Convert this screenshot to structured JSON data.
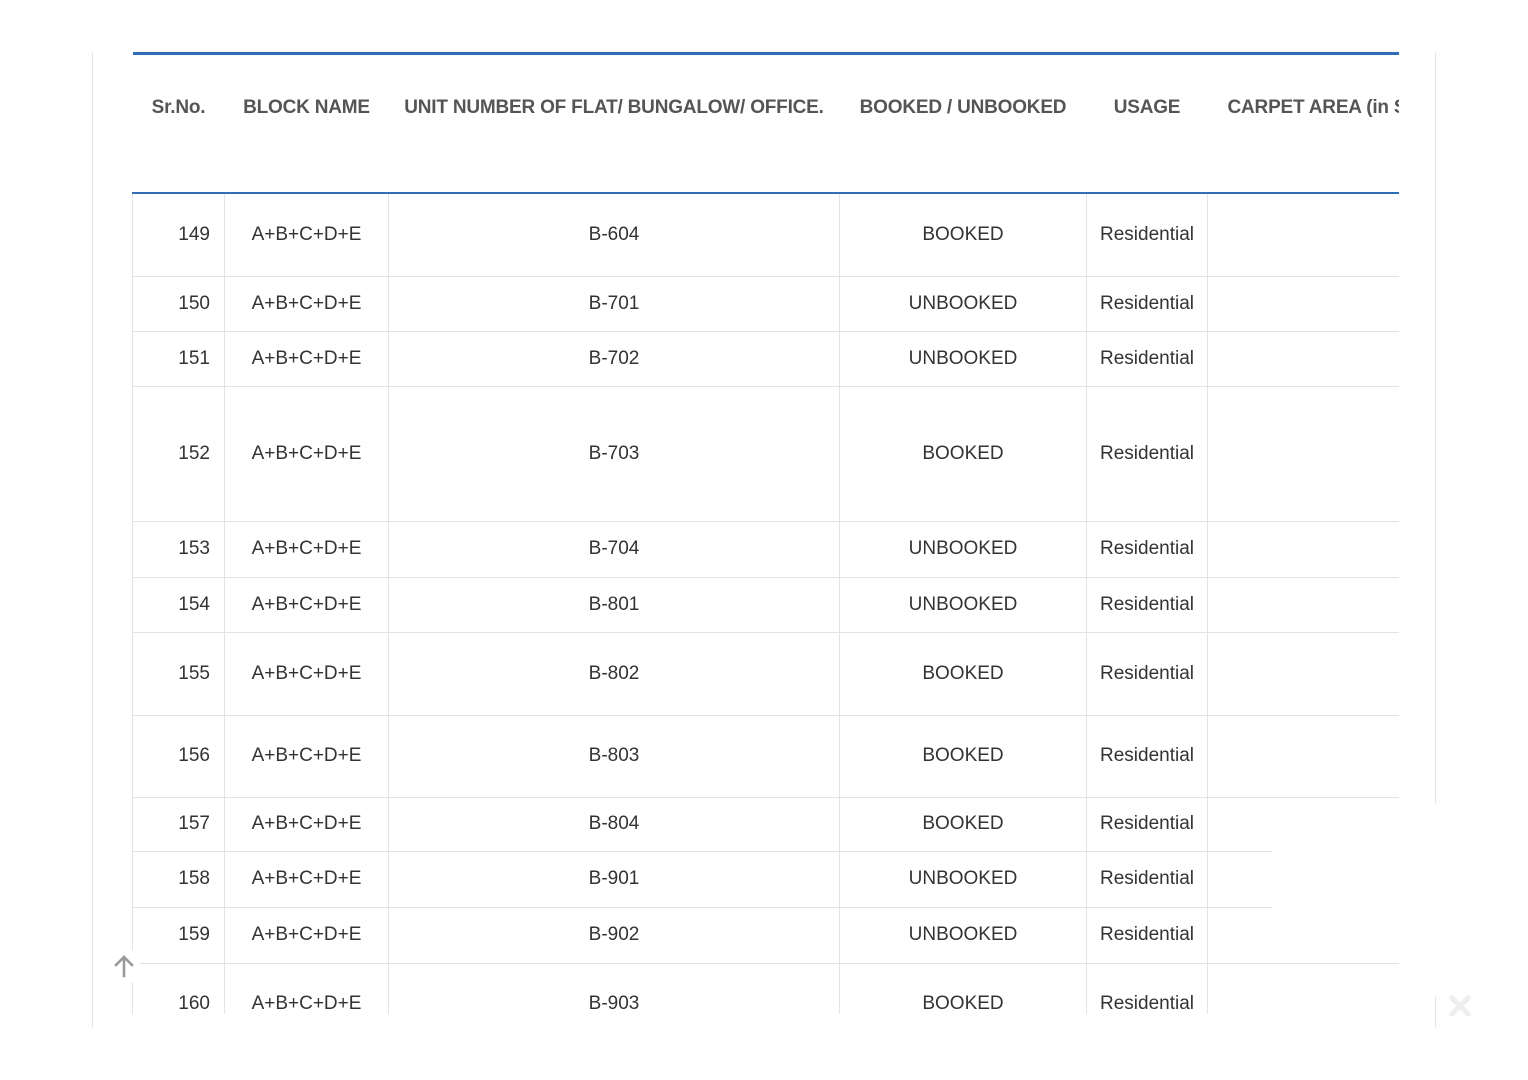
{
  "table": {
    "headers": [
      "Sr.No.",
      "BLOCK NAME",
      "UNIT NUMBER OF FLAT/ BUNGALOW/ OFFICE.",
      "BOOKED / UNBOOKED",
      "USAGE",
      "CARPET AREA (in Sq"
    ],
    "rows": [
      {
        "sr": "149",
        "block": "A+B+C+D+E",
        "unit": "B-604",
        "status": "BOOKED",
        "usage": "Residential",
        "area": ""
      },
      {
        "sr": "150",
        "block": "A+B+C+D+E",
        "unit": "B-701",
        "status": "UNBOOKED",
        "usage": "Residential",
        "area": ""
      },
      {
        "sr": "151",
        "block": "A+B+C+D+E",
        "unit": "B-702",
        "status": "UNBOOKED",
        "usage": "Residential",
        "area": ""
      },
      {
        "sr": "152",
        "block": "A+B+C+D+E",
        "unit": "B-703",
        "status": "BOOKED",
        "usage": "Residential",
        "area": ""
      },
      {
        "sr": "153",
        "block": "A+B+C+D+E",
        "unit": "B-704",
        "status": "UNBOOKED",
        "usage": "Residential",
        "area": ""
      },
      {
        "sr": "154",
        "block": "A+B+C+D+E",
        "unit": "B-801",
        "status": "UNBOOKED",
        "usage": "Residential",
        "area": ""
      },
      {
        "sr": "155",
        "block": "A+B+C+D+E",
        "unit": "B-802",
        "status": "BOOKED",
        "usage": "Residential",
        "area": ""
      },
      {
        "sr": "156",
        "block": "A+B+C+D+E",
        "unit": "B-803",
        "status": "BOOKED",
        "usage": "Residential",
        "area": ""
      },
      {
        "sr": "157",
        "block": "A+B+C+D+E",
        "unit": "B-804",
        "status": "BOOKED",
        "usage": "Residential",
        "area": ""
      },
      {
        "sr": "158",
        "block": "A+B+C+D+E",
        "unit": "B-901",
        "status": "UNBOOKED",
        "usage": "Residential",
        "area": ""
      },
      {
        "sr": "159",
        "block": "A+B+C+D+E",
        "unit": "B-902",
        "status": "UNBOOKED",
        "usage": "Residential",
        "area": ""
      },
      {
        "sr": "160",
        "block": "A+B+C+D+E",
        "unit": "B-903",
        "status": "BOOKED",
        "usage": "Residential",
        "area": ""
      }
    ]
  },
  "controls": {
    "scroll_top_icon": "arrow-up-icon",
    "close_icon": "close-icon"
  },
  "colors": {
    "header_rule": "#2f6db5",
    "grid_line": "#e3e3e3",
    "text": "#333333",
    "header_text": "#555555",
    "icon_gray": "#9a9a9a"
  }
}
